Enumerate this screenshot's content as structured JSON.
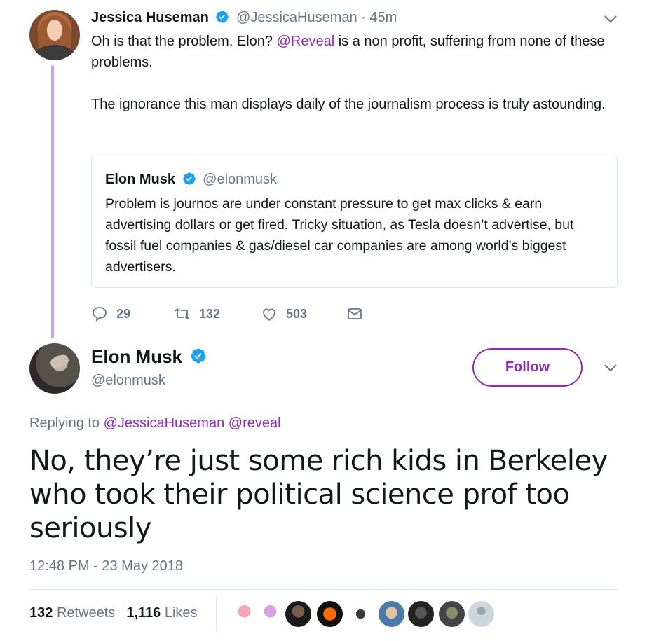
{
  "quoted_thread": {
    "author_name": "Jessica Huseman",
    "author_handle": "@JessicaHuseman",
    "time": "45m",
    "text_part1": "Oh is that the problem, Elon? ",
    "text_mention": "@Reveal",
    "text_part2": " is a non profit, suffering from none of these problems.",
    "text_para2": "The ignorance this man displays daily of the journalism process is truly astounding.",
    "quote": {
      "author_name": "Elon Musk",
      "author_handle": "@elonmusk",
      "text": "Problem is journos are under constant pressure to get max clicks & earn advertising dollars or get fired. Tricky situation, as Tesla doesn’t advertise, but fossil fuel companies & gas/diesel car companies are among world’s biggest advertisers."
    },
    "actions": {
      "replies": "29",
      "retweets": "132",
      "likes": "503"
    }
  },
  "main_tweet": {
    "author_name": "Elon Musk",
    "author_handle": "@elonmusk",
    "follow_label": "Follow",
    "replying_prefix": "Replying to",
    "replying_to_1": "@JessicaHuseman",
    "replying_to_2": "@reveal",
    "text": "No, they’re just some rich kids in Berkeley who took their political science prof too seriously",
    "timestamp": "12:48 PM - 23 May 2018",
    "retweet_count": "132",
    "retweet_label": "Retweets",
    "like_count": "1,116",
    "like_label": "Likes"
  },
  "colors": {
    "accent": "#8e2bb8",
    "thread_line": "#c9a6ec",
    "verified": "#1da1f2",
    "muted": "#657786"
  },
  "icons": [
    "verified-badge-icon",
    "chevron-down-icon",
    "reply-icon",
    "retweet-icon",
    "like-icon",
    "direct-message-icon"
  ]
}
